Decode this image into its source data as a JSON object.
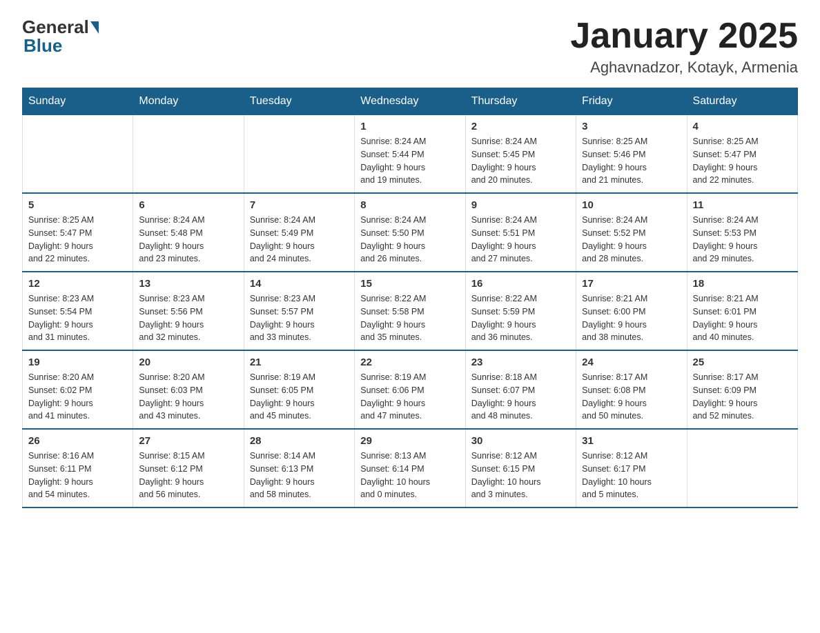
{
  "header": {
    "title": "January 2025",
    "subtitle": "Aghavnadzor, Kotayk, Armenia",
    "logo_general": "General",
    "logo_blue": "Blue"
  },
  "weekdays": [
    "Sunday",
    "Monday",
    "Tuesday",
    "Wednesday",
    "Thursday",
    "Friday",
    "Saturday"
  ],
  "weeks": [
    [
      {
        "day": "",
        "info": ""
      },
      {
        "day": "",
        "info": ""
      },
      {
        "day": "",
        "info": ""
      },
      {
        "day": "1",
        "info": "Sunrise: 8:24 AM\nSunset: 5:44 PM\nDaylight: 9 hours\nand 19 minutes."
      },
      {
        "day": "2",
        "info": "Sunrise: 8:24 AM\nSunset: 5:45 PM\nDaylight: 9 hours\nand 20 minutes."
      },
      {
        "day": "3",
        "info": "Sunrise: 8:25 AM\nSunset: 5:46 PM\nDaylight: 9 hours\nand 21 minutes."
      },
      {
        "day": "4",
        "info": "Sunrise: 8:25 AM\nSunset: 5:47 PM\nDaylight: 9 hours\nand 22 minutes."
      }
    ],
    [
      {
        "day": "5",
        "info": "Sunrise: 8:25 AM\nSunset: 5:47 PM\nDaylight: 9 hours\nand 22 minutes."
      },
      {
        "day": "6",
        "info": "Sunrise: 8:24 AM\nSunset: 5:48 PM\nDaylight: 9 hours\nand 23 minutes."
      },
      {
        "day": "7",
        "info": "Sunrise: 8:24 AM\nSunset: 5:49 PM\nDaylight: 9 hours\nand 24 minutes."
      },
      {
        "day": "8",
        "info": "Sunrise: 8:24 AM\nSunset: 5:50 PM\nDaylight: 9 hours\nand 26 minutes."
      },
      {
        "day": "9",
        "info": "Sunrise: 8:24 AM\nSunset: 5:51 PM\nDaylight: 9 hours\nand 27 minutes."
      },
      {
        "day": "10",
        "info": "Sunrise: 8:24 AM\nSunset: 5:52 PM\nDaylight: 9 hours\nand 28 minutes."
      },
      {
        "day": "11",
        "info": "Sunrise: 8:24 AM\nSunset: 5:53 PM\nDaylight: 9 hours\nand 29 minutes."
      }
    ],
    [
      {
        "day": "12",
        "info": "Sunrise: 8:23 AM\nSunset: 5:54 PM\nDaylight: 9 hours\nand 31 minutes."
      },
      {
        "day": "13",
        "info": "Sunrise: 8:23 AM\nSunset: 5:56 PM\nDaylight: 9 hours\nand 32 minutes."
      },
      {
        "day": "14",
        "info": "Sunrise: 8:23 AM\nSunset: 5:57 PM\nDaylight: 9 hours\nand 33 minutes."
      },
      {
        "day": "15",
        "info": "Sunrise: 8:22 AM\nSunset: 5:58 PM\nDaylight: 9 hours\nand 35 minutes."
      },
      {
        "day": "16",
        "info": "Sunrise: 8:22 AM\nSunset: 5:59 PM\nDaylight: 9 hours\nand 36 minutes."
      },
      {
        "day": "17",
        "info": "Sunrise: 8:21 AM\nSunset: 6:00 PM\nDaylight: 9 hours\nand 38 minutes."
      },
      {
        "day": "18",
        "info": "Sunrise: 8:21 AM\nSunset: 6:01 PM\nDaylight: 9 hours\nand 40 minutes."
      }
    ],
    [
      {
        "day": "19",
        "info": "Sunrise: 8:20 AM\nSunset: 6:02 PM\nDaylight: 9 hours\nand 41 minutes."
      },
      {
        "day": "20",
        "info": "Sunrise: 8:20 AM\nSunset: 6:03 PM\nDaylight: 9 hours\nand 43 minutes."
      },
      {
        "day": "21",
        "info": "Sunrise: 8:19 AM\nSunset: 6:05 PM\nDaylight: 9 hours\nand 45 minutes."
      },
      {
        "day": "22",
        "info": "Sunrise: 8:19 AM\nSunset: 6:06 PM\nDaylight: 9 hours\nand 47 minutes."
      },
      {
        "day": "23",
        "info": "Sunrise: 8:18 AM\nSunset: 6:07 PM\nDaylight: 9 hours\nand 48 minutes."
      },
      {
        "day": "24",
        "info": "Sunrise: 8:17 AM\nSunset: 6:08 PM\nDaylight: 9 hours\nand 50 minutes."
      },
      {
        "day": "25",
        "info": "Sunrise: 8:17 AM\nSunset: 6:09 PM\nDaylight: 9 hours\nand 52 minutes."
      }
    ],
    [
      {
        "day": "26",
        "info": "Sunrise: 8:16 AM\nSunset: 6:11 PM\nDaylight: 9 hours\nand 54 minutes."
      },
      {
        "day": "27",
        "info": "Sunrise: 8:15 AM\nSunset: 6:12 PM\nDaylight: 9 hours\nand 56 minutes."
      },
      {
        "day": "28",
        "info": "Sunrise: 8:14 AM\nSunset: 6:13 PM\nDaylight: 9 hours\nand 58 minutes."
      },
      {
        "day": "29",
        "info": "Sunrise: 8:13 AM\nSunset: 6:14 PM\nDaylight: 10 hours\nand 0 minutes."
      },
      {
        "day": "30",
        "info": "Sunrise: 8:12 AM\nSunset: 6:15 PM\nDaylight: 10 hours\nand 3 minutes."
      },
      {
        "day": "31",
        "info": "Sunrise: 8:12 AM\nSunset: 6:17 PM\nDaylight: 10 hours\nand 5 minutes."
      },
      {
        "day": "",
        "info": ""
      }
    ]
  ]
}
